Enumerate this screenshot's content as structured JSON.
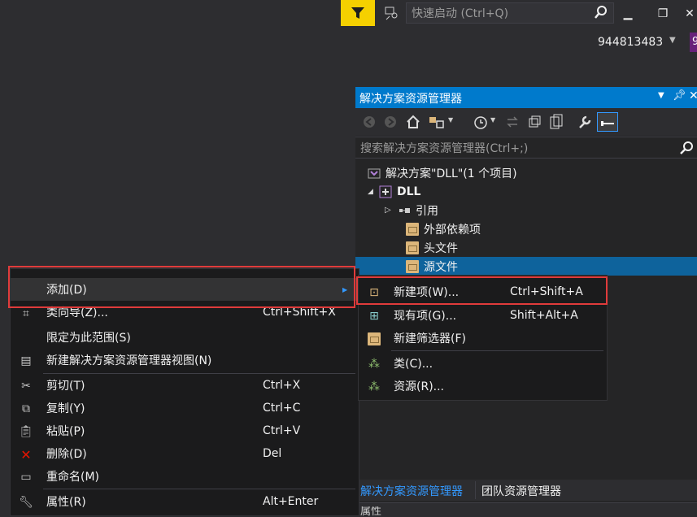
{
  "topbar": {
    "quick_launch_placeholder": "快速启动 (Ctrl+Q)",
    "user_name": "944813483",
    "user_badge": "9"
  },
  "solution_explorer": {
    "title": "解决方案资源管理器",
    "search_placeholder": "搜索解决方案资源管理器(Ctrl+;)",
    "tree": {
      "solution": "解决方案\"DLL\"(1 个项目)",
      "project": "DLL",
      "references": "引用",
      "external_deps": "外部依赖项",
      "header_files": "头文件",
      "source_files": "源文件"
    },
    "tabs": [
      "解决方案资源管理器",
      "团队资源管理器"
    ],
    "bottom_partial": "属性"
  },
  "context_menu": {
    "items": [
      {
        "label": "添加(D)",
        "shortcut": ""
      },
      {
        "label": "类向导(Z)...",
        "shortcut": "Ctrl+Shift+X"
      },
      {
        "label": "限定为此范围(S)",
        "shortcut": ""
      },
      {
        "label": "新建解决方案资源管理器视图(N)",
        "shortcut": ""
      },
      {
        "label": "剪切(T)",
        "shortcut": "Ctrl+X"
      },
      {
        "label": "复制(Y)",
        "shortcut": "Ctrl+C"
      },
      {
        "label": "粘贴(P)",
        "shortcut": "Ctrl+V"
      },
      {
        "label": "删除(D)",
        "shortcut": "Del"
      },
      {
        "label": "重命名(M)",
        "shortcut": ""
      },
      {
        "label": "属性(R)",
        "shortcut": "Alt+Enter"
      }
    ]
  },
  "submenu": {
    "items": [
      {
        "label": "新建项(W)...",
        "shortcut": "Ctrl+Shift+A"
      },
      {
        "label": "现有项(G)...",
        "shortcut": "Shift+Alt+A"
      },
      {
        "label": "新建筛选器(F)",
        "shortcut": ""
      },
      {
        "label": "类(C)...",
        "shortcut": ""
      },
      {
        "label": "资源(R)...",
        "shortcut": ""
      }
    ]
  },
  "colors": {
    "accent": "#007acc",
    "highlight_box": "#e03b3b",
    "filter_button": "#f5d000",
    "selected_row": "#0e639c"
  }
}
